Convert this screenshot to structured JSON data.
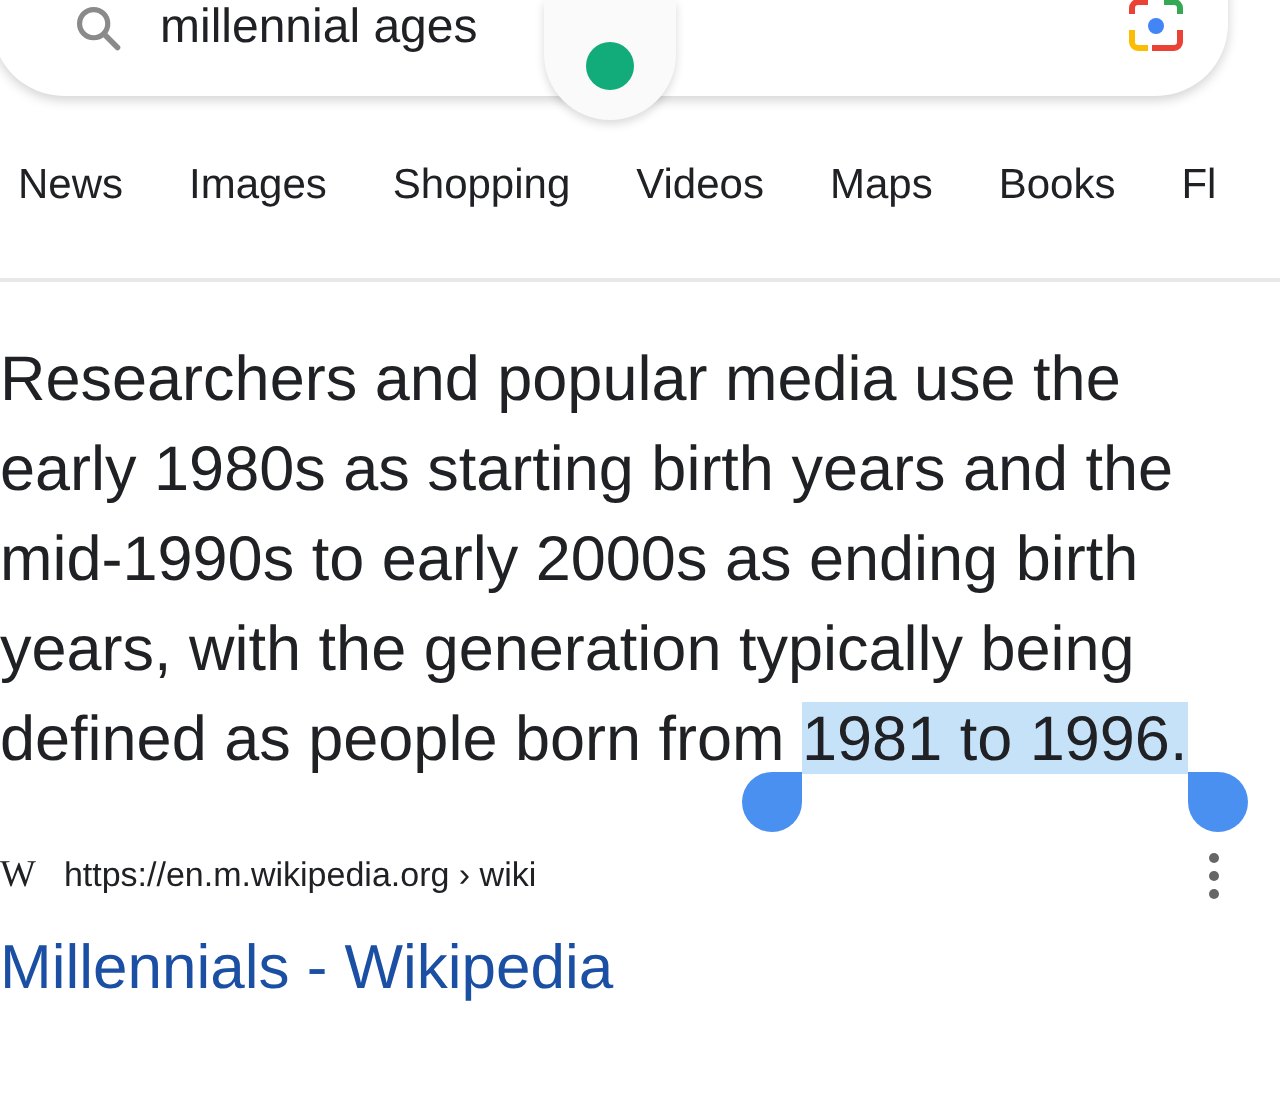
{
  "search": {
    "query": "millennial ages"
  },
  "tabs": [
    {
      "label": "News"
    },
    {
      "label": "Images"
    },
    {
      "label": "Shopping"
    },
    {
      "label": "Videos"
    },
    {
      "label": "Maps"
    },
    {
      "label": "Books"
    },
    {
      "label": "Fl"
    }
  ],
  "snippet": {
    "text": "Researchers and popular media use the early 1980s as starting birth years and the mid-1990s to early 2000s as ending birth years, with the generation typically being defined as people born from ",
    "selection": "1981 to 1996."
  },
  "result": {
    "favicon": "W",
    "url": "https://en.m.wikipedia.org › wiki",
    "title": "Millennials - Wikipedia"
  }
}
